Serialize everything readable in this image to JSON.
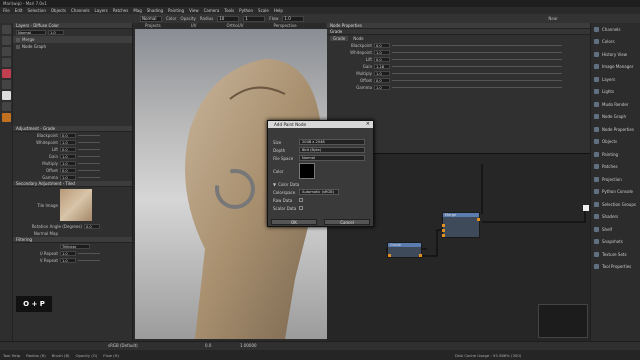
{
  "window": {
    "title": "Mari(wip) - Mari 7.0v1"
  },
  "menu": [
    "File",
    "Edit",
    "Selection",
    "Objects",
    "Channels",
    "Layers",
    "Patches",
    "Mag",
    "Shading",
    "Painting",
    "View",
    "Camera",
    "Tools",
    "Python",
    "Scale",
    "Help"
  ],
  "toolbar": {
    "mode": "Normal",
    "color_label": "Color",
    "opacity_label": "Opacity",
    "radius_label": "Radius",
    "flow_label": "Flow",
    "radius_value": "10",
    "opacity_value": "1",
    "flow_value": "1.0",
    "preset": "Near"
  },
  "left_panel": {
    "header": "Layers - Diffuse Color",
    "blend": "Normal",
    "layer_opacity": "1.0",
    "layers": [
      "Merge",
      "Node Graph"
    ],
    "adjust_header": "Adjustment - Grade",
    "grade_rows": [
      {
        "label": "Blackpoint",
        "value": "0.0"
      },
      {
        "label": "Whitepoint",
        "value": "1.0"
      },
      {
        "label": "Lift",
        "value": "0.0"
      },
      {
        "label": "Gain",
        "value": "1.0"
      },
      {
        "label": "Multiply",
        "value": "1.0"
      },
      {
        "label": "Offset",
        "value": "0.0"
      },
      {
        "label": "Gamma",
        "value": "1.0"
      }
    ],
    "secondary_header": "Secondary Adjustment - Tiled",
    "tile_label": "Tile Image",
    "rotation_label": "Rotation Angle (Degrees)",
    "rotation_value": "0.0",
    "normal_map_label": "Normal Map",
    "filtering_header": "Filtering",
    "filter_value": "Trilinear",
    "u_repeat_label": "U Repeat",
    "u_repeat": "1.0",
    "v_repeat_label": "V Repeat",
    "v_repeat": "1.0"
  },
  "viewport_tabs": [
    "Projects",
    "UV",
    "OrthoUV",
    "Perspective",
    "Ortho"
  ],
  "right_panel": {
    "header": "Node Properties",
    "section": "Grade",
    "tabs": [
      "Grade",
      "Node"
    ],
    "rows": [
      {
        "label": "Blackpoint",
        "value": "0.0"
      },
      {
        "label": "Whitepoint",
        "value": "1.0"
      },
      {
        "label": "Lift",
        "value": "0.0"
      },
      {
        "label": "Gain",
        "value": "1.28"
      },
      {
        "label": "Multiply",
        "value": "1.0"
      },
      {
        "label": "Offset",
        "value": "0.0"
      },
      {
        "label": "Gamma",
        "value": "1.0"
      }
    ]
  },
  "dialog": {
    "title": "Add Paint Node",
    "size_label": "Size",
    "size_value": "2048 x 2048",
    "depth_label": "Depth",
    "depth_value": "8bit (Byte)",
    "space_label": "File Space",
    "space_value": "Normal",
    "color_label": "Color",
    "color_data_header": "Color Data",
    "colorspace_label": "Colorspace",
    "colorspace_value": "Automatic (sRGB)",
    "raw_label": "Raw Data",
    "scalar_label": "Scalar Data",
    "ok": "OK",
    "cancel": "Cancel"
  },
  "nodes": [
    {
      "title": "Grade"
    },
    {
      "title": "Merge"
    }
  ],
  "dock": [
    "Channels",
    "Colors",
    "History View",
    "Image Manager",
    "Layers",
    "Lights",
    "Mudo Render",
    "Node Graph",
    "Node Properties",
    "Objects",
    "Painting",
    "Patches",
    "Projection",
    "Python Console",
    "Selection Groups",
    "Shaders",
    "Shelf",
    "Snapshots",
    "Texture Sets",
    "Tool Properties"
  ],
  "shortcut": "O + P",
  "status": {
    "left": "Tool Help",
    "radius": "Radius (R)",
    "brush": "Brush (B)",
    "opacity": "Opacity (O)",
    "flow": "Flow (H)",
    "right": "Disk Cache Usage : 55.586% (300)"
  },
  "bottom": {
    "colorspace": "sRGB (Default)",
    "gain": "1.00000",
    "zoom": "0.0"
  }
}
